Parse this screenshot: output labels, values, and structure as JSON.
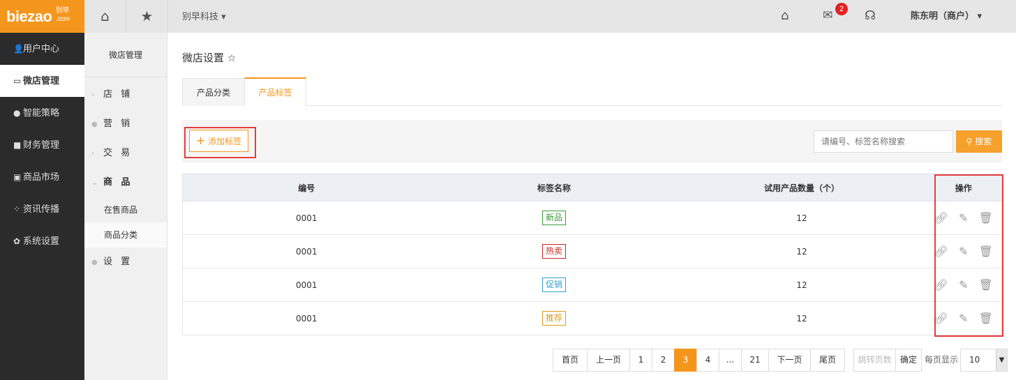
{
  "logo": {
    "text": "biezao",
    "cn": "别早",
    "sub": ".com"
  },
  "sidebar": [
    {
      "icon": "user-icon",
      "glyph": "👤",
      "label": "用户中心"
    },
    {
      "icon": "shop-icon",
      "glyph": "▭",
      "label": "微店管理",
      "active": true
    },
    {
      "icon": "strategy-icon",
      "glyph": "●",
      "label": "智能策略"
    },
    {
      "icon": "finance-icon",
      "glyph": "■",
      "label": "财务管理"
    },
    {
      "icon": "market-icon",
      "glyph": "▣",
      "label": "商品市场"
    },
    {
      "icon": "news-icon",
      "glyph": "⁘",
      "label": "资讯传播"
    },
    {
      "icon": "settings-icon",
      "glyph": "✿",
      "label": "系统设置"
    }
  ],
  "topbar": {
    "company": "别早科技",
    "badge": "2",
    "user": "陈东明（商户）"
  },
  "subnav": {
    "title": "微店管理",
    "items": [
      "店 铺",
      "营 销",
      "交 易",
      "商 品",
      "在售商品",
      "商品分类",
      "设 置"
    ]
  },
  "page": {
    "title": "微店设置",
    "tabs": [
      "产品分类",
      "产品标签"
    ]
  },
  "toolbar": {
    "add": "添加标签",
    "search_placeholder": "请编号、标签名称搜索",
    "search_btn": "搜索"
  },
  "table": {
    "headers": [
      "编号",
      "标签名称",
      "试用产品数量（个）",
      "操作"
    ],
    "rows": [
      {
        "id": "0001",
        "tag": "新品",
        "count": "12",
        "color": "#3a9a3a"
      },
      {
        "id": "0001",
        "tag": "热卖",
        "count": "12",
        "color": "#c62828"
      },
      {
        "id": "0001",
        "tag": "促销",
        "count": "12",
        "color": "#2fa2c8"
      },
      {
        "id": "0001",
        "tag": "推荐",
        "count": "12",
        "color": "#e09a1a"
      }
    ]
  },
  "pager": {
    "first": "首页",
    "prev": "上一页",
    "pages": [
      "1",
      "2",
      "3",
      "4",
      "...",
      "21"
    ],
    "current": "3",
    "next": "下一页",
    "last": "尾页",
    "jump": "跳转页数",
    "confirm": "确定",
    "per_page_label": "每页显示",
    "per_page": "10"
  }
}
